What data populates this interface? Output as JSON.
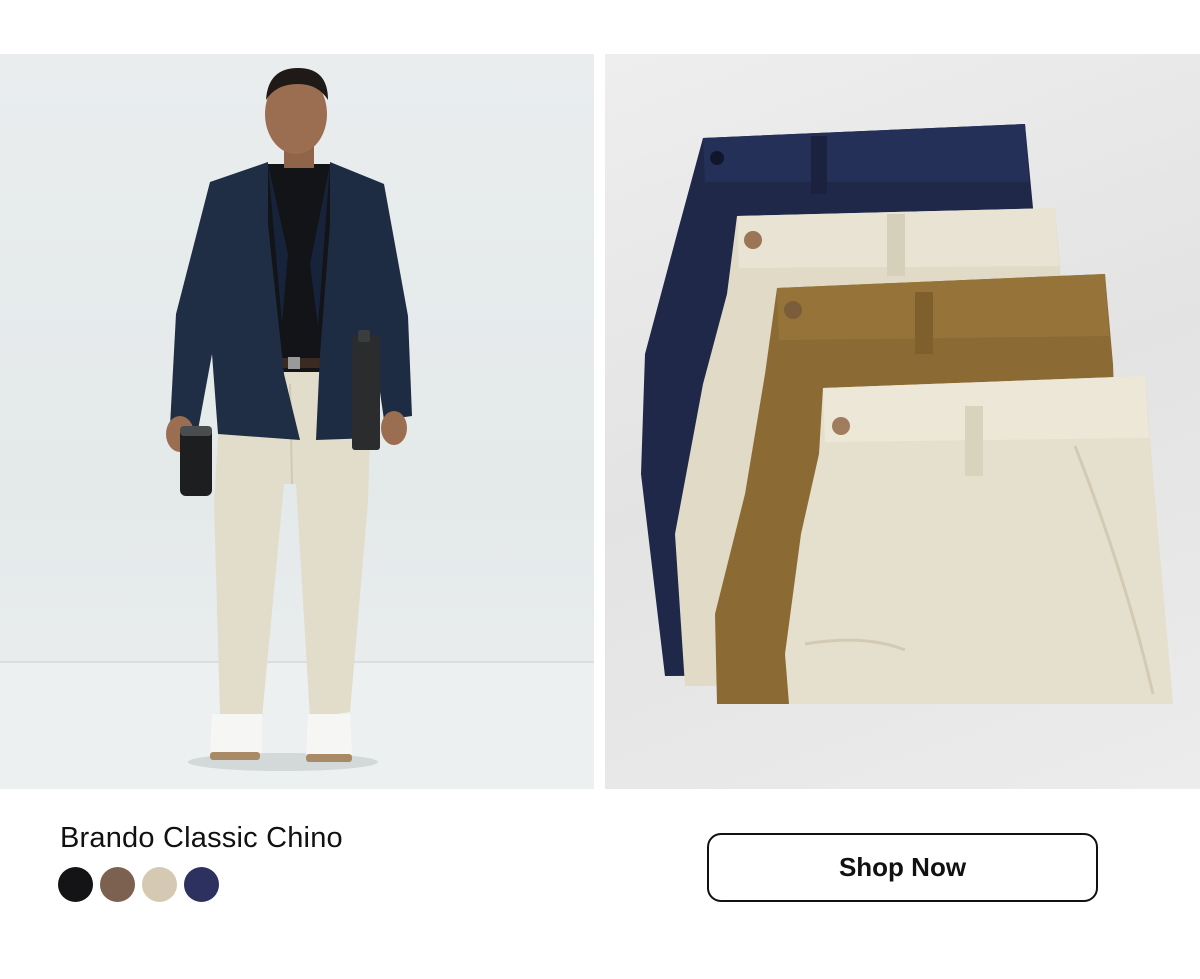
{
  "product": {
    "name": "Brando Classic Chino",
    "swatches": [
      {
        "name": "black",
        "color": "#141416"
      },
      {
        "name": "brown",
        "color": "#7c6050"
      },
      {
        "name": "khaki",
        "color": "#d5c9b3"
      },
      {
        "name": "navy",
        "color": "#2c3160"
      }
    ]
  },
  "cta": {
    "label": "Shop Now"
  },
  "images": {
    "model_photo": "model-wearing-chinos-image",
    "folded_photo": "folded-chinos-stack-image"
  }
}
